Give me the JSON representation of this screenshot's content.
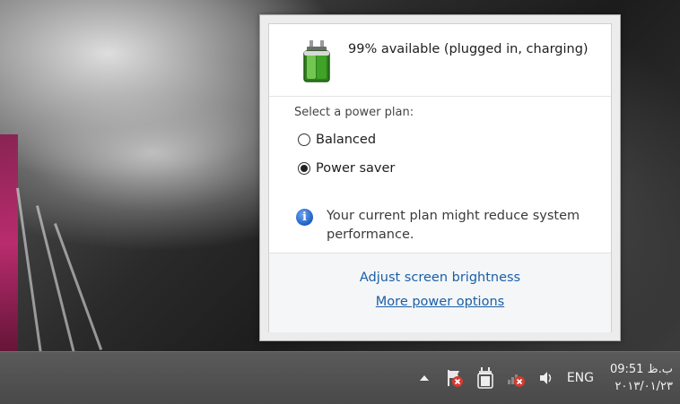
{
  "power_flyout": {
    "status_text": "99% available (plugged in, charging)",
    "battery_percent": 99,
    "select_label": "Select a power plan:",
    "plans": [
      {
        "label": "Balanced",
        "selected": false
      },
      {
        "label": "Power saver",
        "selected": true
      }
    ],
    "info_text": "Your current plan might reduce system performance.",
    "links": {
      "brightness": "Adjust screen brightness",
      "more_options": "More power options"
    }
  },
  "taskbar": {
    "tray_icons": [
      "show-hidden-icons-arrow",
      "action-center-flag-icon",
      "battery-plug-icon",
      "network-disconnected-icon",
      "volume-icon"
    ],
    "language": "ENG",
    "time": "09:51 ب.ظ",
    "date": "۲۰۱۳/۰۱/۲۳"
  },
  "colors": {
    "link": "#1b5fa6",
    "taskbar": "#4f4f4f",
    "error_red": "#d63a2f"
  }
}
